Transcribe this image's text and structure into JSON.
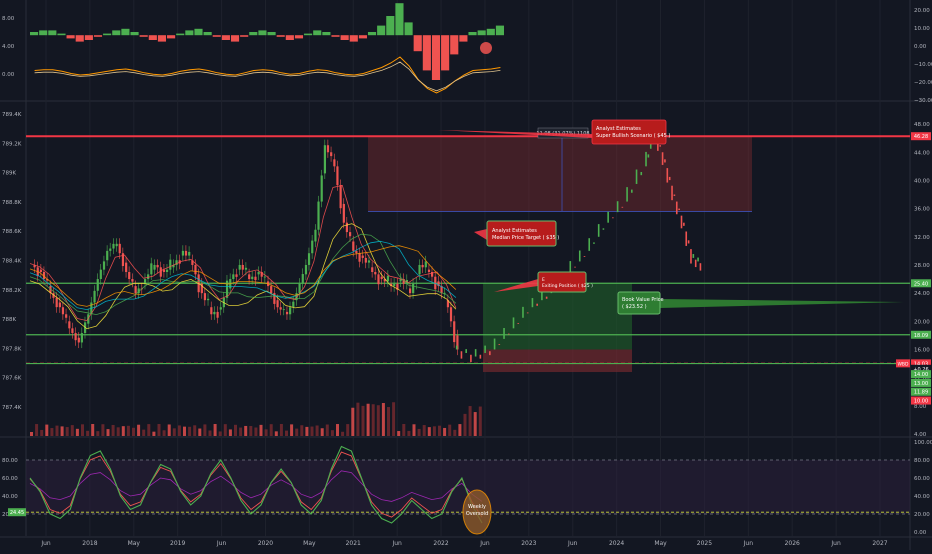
{
  "chart_data": {
    "type": "line",
    "x_axis": {
      "labels": [
        "Jun",
        "2018",
        "May",
        "2019",
        "Jun",
        "2020",
        "May",
        "2021",
        "Jun",
        "2022",
        "Jun",
        "2023",
        "Jun",
        "2024",
        "May",
        "2025",
        "Jun",
        "2026",
        "Jun",
        "2027"
      ]
    },
    "panels": [
      {
        "name": "oscillator",
        "type": "bar",
        "left_ticks": [
          "8.00",
          "4.00",
          "0.00"
        ],
        "right_ticks": [
          "20.00",
          "10.00",
          "0.00",
          "−10.00",
          "−20.00",
          "−30.00"
        ],
        "ylim": [
          -30,
          20
        ],
        "values": [
          2,
          3,
          3,
          1,
          -2,
          -4,
          -3,
          -1,
          1,
          3,
          4,
          2,
          -1,
          -3,
          -4,
          -2,
          1,
          3,
          4,
          2,
          -1,
          -3,
          -4,
          -1,
          2,
          3,
          2,
          -1,
          -3,
          -2,
          1,
          3,
          2,
          -1,
          -3,
          -4,
          -2,
          2,
          6,
          12,
          20,
          8,
          -10,
          -22,
          -28,
          -22,
          -12,
          -4,
          2,
          3,
          4,
          6
        ]
      },
      {
        "name": "price",
        "type": "candlestick",
        "left_ticks": [
          "789.4K",
          "789.2K",
          "789K",
          "788.8K",
          "788.6K",
          "788.4K",
          "788.2K",
          "788K",
          "787.8K",
          "787.6K",
          "787.4K"
        ],
        "right_ticks": [
          "48.00",
          "44.00",
          "40.00",
          "36.00",
          "32.00",
          "28.00",
          "24.00",
          "20.00",
          "16.00",
          "12.00",
          "8.00",
          "4.00"
        ],
        "ylim": [
          4,
          50
        ],
        "close_series": [
          [
            0,
            28
          ],
          [
            1,
            27
          ],
          [
            2,
            24
          ],
          [
            3,
            22
          ],
          [
            4,
            19
          ],
          [
            5,
            17
          ],
          [
            6,
            21
          ],
          [
            7,
            26
          ],
          [
            8,
            30
          ],
          [
            9,
            31
          ],
          [
            10,
            27
          ],
          [
            11,
            24
          ],
          [
            12,
            26
          ],
          [
            13,
            28
          ],
          [
            14,
            27
          ],
          [
            15,
            28
          ],
          [
            16,
            30
          ],
          [
            17,
            28
          ],
          [
            18,
            24
          ],
          [
            19,
            21
          ],
          [
            20,
            22
          ],
          [
            21,
            26
          ],
          [
            22,
            28
          ],
          [
            23,
            26
          ],
          [
            24,
            27
          ],
          [
            25,
            25
          ],
          [
            26,
            22
          ],
          [
            27,
            21
          ],
          [
            28,
            24
          ],
          [
            29,
            28
          ],
          [
            30,
            33
          ],
          [
            31,
            45
          ],
          [
            32,
            42
          ],
          [
            33,
            34
          ],
          [
            34,
            30
          ],
          [
            35,
            29
          ],
          [
            36,
            27
          ],
          [
            37,
            26
          ],
          [
            38,
            25
          ],
          [
            39,
            26
          ],
          [
            40,
            24
          ],
          [
            41,
            28
          ],
          [
            42,
            27
          ],
          [
            43,
            25
          ],
          [
            44,
            22
          ],
          [
            45,
            16
          ]
        ],
        "projection_series": [
          [
            45,
            16
          ],
          [
            47,
            15
          ],
          [
            49,
            16
          ],
          [
            51,
            19
          ],
          [
            53,
            22
          ],
          [
            55,
            24
          ],
          [
            57,
            27
          ],
          [
            59,
            30
          ],
          [
            61,
            34
          ],
          [
            63,
            37
          ],
          [
            65,
            42
          ],
          [
            66,
            47
          ],
          [
            67,
            43
          ],
          [
            68,
            38
          ],
          [
            69,
            34
          ],
          [
            70,
            29
          ],
          [
            71,
            28
          ]
        ],
        "levels": [
          {
            "value": 46.28,
            "label": "46.28",
            "color": "#f23645"
          },
          {
            "value": 25.4,
            "label": "25.40",
            "color": "#4caf50"
          },
          {
            "value": 18.09,
            "label": "18.09",
            "color": "#4caf50"
          },
          {
            "value": 14.03,
            "label": "14.03",
            "color": "#f23645"
          },
          {
            "value": 14.0,
            "label": "14.00",
            "color": "#4caf50"
          }
        ],
        "price_tags": [
          {
            "value": 46.28,
            "label": "46.28",
            "color": "#f23645"
          },
          {
            "value": 25.4,
            "label": "25.40",
            "color": "#4caf50"
          },
          {
            "value": 18.09,
            "label": "18.09",
            "color": "#4caf50"
          },
          {
            "value": 14.03,
            "label": "14.03",
            "color": "#f23645"
          },
          {
            "value": 13.26,
            "label": "+0.26",
            "color": "#131722"
          },
          {
            "value": 12.5,
            "label": "14.00",
            "color": "#4caf50"
          },
          {
            "value": 11.25,
            "label": "13.00",
            "color": "#4caf50"
          },
          {
            "value": 10.0,
            "label": "11.89",
            "color": "#4caf50"
          },
          {
            "value": 8.75,
            "label": "10.00",
            "color": "#f23645"
          }
        ],
        "symbol_tag": "WBD",
        "annotations": {
          "measure_label": "11.08 (31.07%) 1108",
          "super_bullish": [
            "Analyst Estimates",
            "Super Bullish Scenario (  $45  )"
          ],
          "median_target": [
            "Analyst Estimates",
            "Median Price Target (  $35  )"
          ],
          "exiting_position": [
            "E",
            "Exiting Position (  $25  )"
          ],
          "book_value": [
            "Book Value Price",
            "(  $23.52  )"
          ]
        }
      },
      {
        "name": "rsi",
        "type": "line",
        "left_ticks": [
          "80.00",
          "60.00",
          "40.00",
          "20.00"
        ],
        "right_ticks": [
          "100.00",
          "80.00",
          "60.00",
          "40.00",
          "20.00",
          "0.00"
        ],
        "ylim": [
          0,
          100
        ],
        "values": [
          60,
          45,
          20,
          15,
          25,
          60,
          85,
          90,
          70,
          40,
          25,
          30,
          55,
          75,
          70,
          45,
          30,
          40,
          65,
          80,
          60,
          35,
          20,
          30,
          55,
          70,
          55,
          30,
          20,
          35,
          70,
          95,
          90,
          60,
          30,
          15,
          10,
          20,
          35,
          25,
          15,
          20,
          45,
          60,
          30,
          10
        ],
        "lower_tag": "24.45",
        "label": "Weekly Oversold"
      }
    ]
  },
  "colors": {
    "background": "#131722",
    "up": "#26a69a",
    "down": "#ef5350",
    "green_candle": "#4caf50",
    "red_line": "#f23645"
  }
}
